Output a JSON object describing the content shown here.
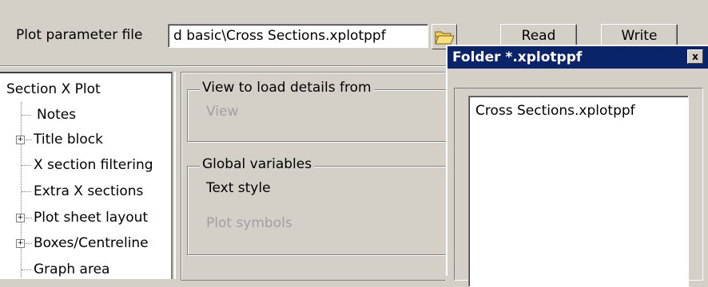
{
  "header": {
    "param_label": "Plot parameter file",
    "param_value": "d basic\\Cross Sections.xplotppf",
    "read_label": "Read",
    "write_label": "Write",
    "folder_icon": "folder-open-icon"
  },
  "tree": {
    "root": "Section X Plot",
    "items": [
      {
        "label": "Notes",
        "expandable": false
      },
      {
        "label": "Title block",
        "expandable": true
      },
      {
        "label": "X section filtering",
        "expandable": false
      },
      {
        "label": "Extra X sections",
        "expandable": false
      },
      {
        "label": "Plot sheet layout",
        "expandable": true
      },
      {
        "label": "Boxes/Centreline",
        "expandable": true
      },
      {
        "label": "Graph area",
        "expandable": false
      }
    ]
  },
  "middle": {
    "group1_title": "View to load details from",
    "group1_view": "View",
    "group2_title": "Global variables",
    "text_style": "Text style",
    "plot_symbols": "Plot symbols"
  },
  "dialog": {
    "title": "Folder *.xplotppf",
    "close": "x",
    "files": [
      "Cross Sections.xplotppf"
    ]
  }
}
